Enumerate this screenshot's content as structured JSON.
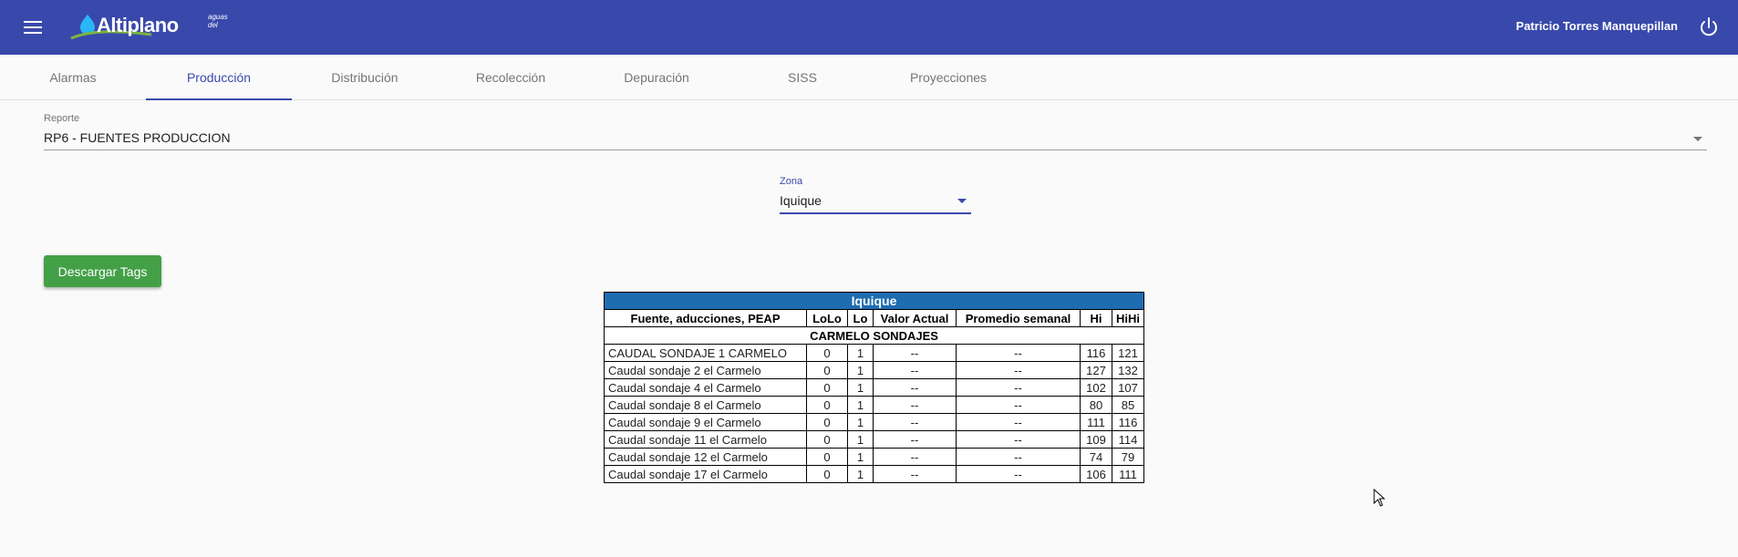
{
  "app": {
    "logo_text": "Altiplano",
    "logo_small": "aguas del"
  },
  "header": {
    "user_name": "Patricio Torres Manquepillan"
  },
  "tabs": [
    {
      "label": "Alarmas",
      "active": false
    },
    {
      "label": "Producción",
      "active": true
    },
    {
      "label": "Distribución",
      "active": false
    },
    {
      "label": "Recolección",
      "active": false
    },
    {
      "label": "Depuración",
      "active": false
    },
    {
      "label": "SISS",
      "active": false
    },
    {
      "label": "Proyecciones",
      "active": false
    }
  ],
  "reporte": {
    "label": "Reporte",
    "value": "RP6 - FUENTES PRODUCCION"
  },
  "zona": {
    "label": "Zona",
    "value": "Iquique"
  },
  "actions": {
    "download_label": "Descargar Tags"
  },
  "table": {
    "title": "Iquique",
    "headers": [
      "Fuente, aducciones, PEAP",
      "LoLo",
      "Lo",
      "Valor Actual",
      "Promedio semanal",
      "Hi",
      "HiHi"
    ],
    "section": "CARMELO SONDAJES",
    "rows": [
      [
        "CAUDAL SONDAJE 1 CARMELO",
        "0",
        "1",
        "--",
        "--",
        "116",
        "121"
      ],
      [
        "Caudal sondaje 2 el Carmelo",
        "0",
        "1",
        "--",
        "--",
        "127",
        "132"
      ],
      [
        "Caudal sondaje 4 el Carmelo",
        "0",
        "1",
        "--",
        "--",
        "102",
        "107"
      ],
      [
        "Caudal sondaje 8 el Carmelo",
        "0",
        "1",
        "--",
        "--",
        "80",
        "85"
      ],
      [
        "Caudal sondaje 9 el Carmelo",
        "0",
        "1",
        "--",
        "--",
        "111",
        "116"
      ],
      [
        "Caudal sondaje 11 el Carmelo",
        "0",
        "1",
        "--",
        "--",
        "109",
        "114"
      ],
      [
        "Caudal sondaje 12 el Carmelo",
        "0",
        "1",
        "--",
        "--",
        "74",
        "79"
      ],
      [
        "Caudal sondaje 17 el Carmelo",
        "0",
        "1",
        "--",
        "--",
        "106",
        "111"
      ]
    ]
  },
  "colors": {
    "primary": "#3949ab",
    "success": "#43a047",
    "table_title_bg": "#1e6db2"
  },
  "icons": [
    "menu-icon",
    "power-icon",
    "chevron-down-icon",
    "mouse-cursor-icon"
  ]
}
